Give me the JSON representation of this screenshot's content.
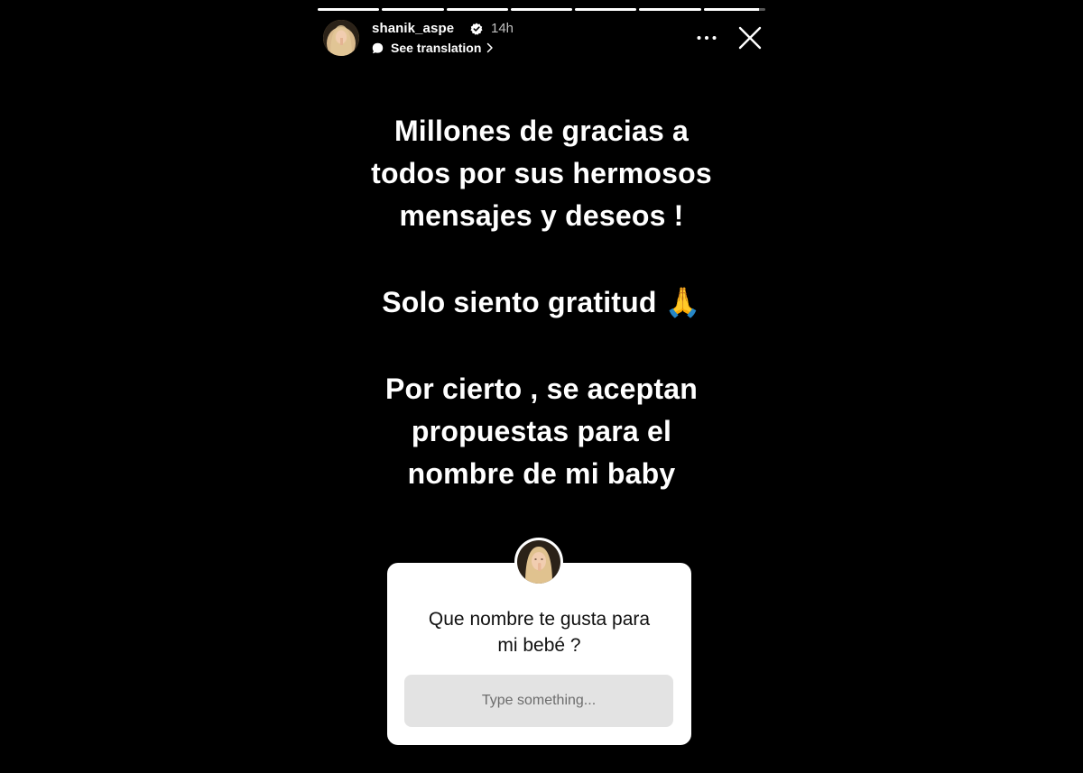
{
  "story": {
    "progress_segments": [
      1,
      1,
      1,
      1,
      1,
      1,
      0.9
    ],
    "author": {
      "username": "shanik_aspe",
      "verified": true,
      "time_ago": "14h",
      "avatar_icon": "profile-photo"
    },
    "see_translation": "See translation",
    "text_paragraphs": [
      [
        "Millones de gracias a",
        "todos por sus hermosos",
        "mensajes y deseos !"
      ],
      [
        "Solo siento gratitud 🙏"
      ],
      [
        "Por cierto , se aceptan",
        "propuestas para el",
        "nombre de mi baby"
      ]
    ],
    "question_sticker": {
      "question_lines": [
        "Que nombre te gusta para",
        "mi bebé ?"
      ],
      "input_placeholder": "Type something..."
    },
    "colors": {
      "background": "#000000",
      "text": "#ffffff",
      "sticker_bg": "#ffffff",
      "input_bg": "#e3e3e3"
    }
  }
}
